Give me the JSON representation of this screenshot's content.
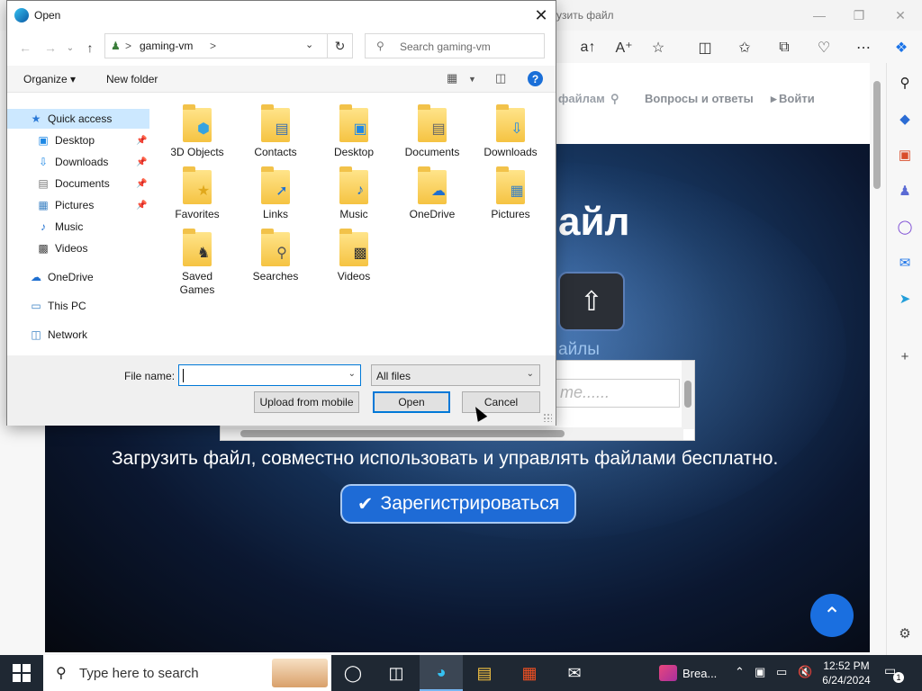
{
  "browser": {
    "tab_title": "узить файл",
    "window_controls": [
      "minimize-icon",
      "restore-icon",
      "close-icon"
    ],
    "toolbar_icons": [
      "read-aloud-icon",
      "text-size-icon",
      "favorite-star-icon",
      "split-screen-icon",
      "favorites-icon",
      "collections-icon",
      "browser-essentials-icon",
      "more-icon",
      "copilot-icon"
    ],
    "rail_icons": [
      "search-icon",
      "shopping-icon",
      "tools-icon",
      "games-icon",
      "office-icon",
      "outlook-icon",
      "telegram-icon",
      "add-icon",
      "settings-icon"
    ]
  },
  "page": {
    "nav": {
      "files_link": "файлам",
      "qa_link": "Вопросы и ответы",
      "login_link": "Войти"
    },
    "hero": {
      "title": "айл",
      "subtitle": "айлы",
      "password_placeholder": "те......",
      "tagline": "Загрузить файл, совместно использовать и управлять файлами бесплатно.",
      "register_label": "Зарегистрироваться"
    }
  },
  "dialog": {
    "title": "Open",
    "address": {
      "location": "gaming-vm",
      "separator": ">"
    },
    "search_placeholder": "Search gaming-vm",
    "command_bar": {
      "organize": "Organize",
      "new_folder": "New folder"
    },
    "nav_pane": [
      {
        "label": "Quick access",
        "icon": "star-icon",
        "pinned": false,
        "selected": true
      },
      {
        "label": "Desktop",
        "icon": "desktop-icon",
        "pinned": true
      },
      {
        "label": "Downloads",
        "icon": "download-arrow-icon",
        "pinned": true
      },
      {
        "label": "Documents",
        "icon": "document-icon",
        "pinned": true
      },
      {
        "label": "Pictures",
        "icon": "picture-icon",
        "pinned": true
      },
      {
        "label": "Music",
        "icon": "music-note-icon",
        "pinned": false
      },
      {
        "label": "Videos",
        "icon": "film-icon",
        "pinned": false
      },
      {
        "label": "OneDrive",
        "icon": "cloud-icon",
        "pinned": false
      },
      {
        "label": "This PC",
        "icon": "computer-icon",
        "pinned": false
      },
      {
        "label": "Network",
        "icon": "network-icon",
        "pinned": false
      }
    ],
    "files": [
      {
        "label": "3D Objects",
        "icon": "cube-icon"
      },
      {
        "label": "Contacts",
        "icon": "contact-card-icon"
      },
      {
        "label": "Desktop",
        "icon": "desktop-icon"
      },
      {
        "label": "Documents",
        "icon": "document-icon"
      },
      {
        "label": "Downloads",
        "icon": "download-arrow-icon"
      },
      {
        "label": "Favorites",
        "icon": "star-icon"
      },
      {
        "label": "Links",
        "icon": "link-arrow-icon"
      },
      {
        "label": "Music",
        "icon": "music-note-icon"
      },
      {
        "label": "OneDrive",
        "icon": "cloud-icon"
      },
      {
        "label": "Pictures",
        "icon": "picture-icon"
      },
      {
        "label": "Saved Games",
        "icon": "chess-piece-icon"
      },
      {
        "label": "Searches",
        "icon": "magnifier-icon"
      },
      {
        "label": "Videos",
        "icon": "film-icon"
      }
    ],
    "file_name_label": "File name:",
    "file_name_value": "",
    "file_type": "All files",
    "buttons": {
      "upload_mobile": "Upload from mobile",
      "open": "Open",
      "cancel": "Cancel"
    }
  },
  "taskbar": {
    "search_placeholder": "Type here to search",
    "apps": [
      "task-view-icon",
      "cortana-icon",
      "edge-icon",
      "file-explorer-icon",
      "store-icon",
      "mail-icon"
    ],
    "running_task": "Brea...",
    "time": "12:52 PM",
    "date": "6/24/2024",
    "notification_count": "1"
  },
  "colors": {
    "selection": "#cce8ff",
    "accent": "#0078d7",
    "taskbar": "#1f2833",
    "register_button": "#1e6bd6"
  }
}
